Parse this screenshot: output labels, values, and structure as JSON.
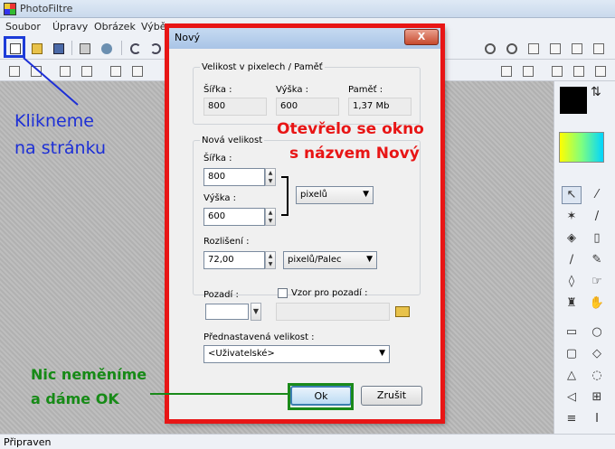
{
  "app": {
    "title": "PhotoFiltre",
    "menu": [
      "Soubor",
      "Úpravy",
      "Obrázek",
      "Výběr"
    ],
    "status": "Připraven"
  },
  "dialog": {
    "title": "Nový",
    "close_label": "X",
    "current": {
      "group_label": "Velikost v pixelech / Paměť",
      "width_label": "Šířka :",
      "height_label": "Výška :",
      "memory_label": "Paměť :",
      "width_value": "800",
      "height_value": "600",
      "memory_value": "1,37 Mb"
    },
    "new_size": {
      "group_label": "Nová velikost",
      "width_label": "Šířka :",
      "width_value": "800",
      "height_label": "Výška :",
      "height_value": "600",
      "unit_selected": "pixelů",
      "resolution_label": "Rozlišení :",
      "resolution_value": "72,00",
      "resolution_unit": "pixelů/Palec"
    },
    "background_label": "Pozadí :",
    "pattern_checkbox_label": "Vzor pro pozadí :",
    "preset_label": "Přednastavená velikost :",
    "preset_value": "<Uživatelské>",
    "ok_label": "Ok",
    "cancel_label": "Zrušit"
  },
  "annotations": {
    "blue_line1": "Klikneme",
    "blue_line2": "na stránku",
    "red_line1": "Otevřelo se okno",
    "red_line2": "s názvem Nový",
    "green_line1": "Nic neměníme",
    "green_line2": "a dáme OK"
  },
  "colors": {
    "annotation_red": "#e81515",
    "annotation_blue": "#1d2fd6",
    "annotation_green": "#168a16"
  }
}
